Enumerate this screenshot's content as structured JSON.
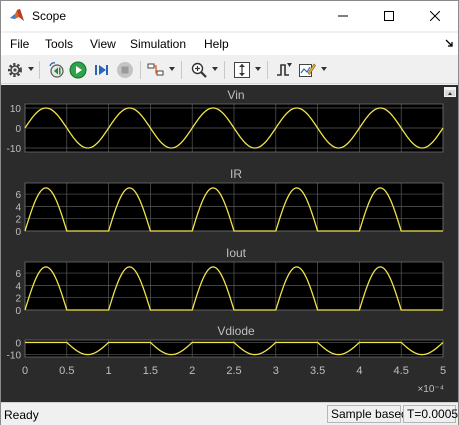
{
  "window": {
    "title": "Scope",
    "app_icon": "matlab-logo-icon"
  },
  "titlebar_buttons": [
    "minimize-icon",
    "maximize-icon",
    "close-icon"
  ],
  "menu": {
    "items": [
      "File",
      "Tools",
      "View",
      "Simulation",
      "Help"
    ],
    "overflow_icon": "chevron-arrow-icon"
  },
  "toolbar": {
    "icons": [
      "gear-icon",
      "dropdown-icon",
      "step-back-icon",
      "run-icon",
      "step-forward-icon",
      "stop-icon",
      "signal-select-icon",
      "dropdown-icon",
      "zoom-icon",
      "dropdown-icon",
      "fit-axes-icon",
      "dropdown-icon",
      "trigger-icon",
      "style-edit-icon",
      "dropdown-icon"
    ]
  },
  "colors": {
    "plot_background": "#2b2b2b",
    "axes_background": "#000000",
    "trace": "#f0e44a",
    "grid": "#5a5a5a",
    "text": "#bfbfbf"
  },
  "chart_data": [
    {
      "type": "line",
      "title": "Vin",
      "x_range": [
        0,
        0.0005
      ],
      "ylim": [
        -12,
        12
      ],
      "yticks": [
        "10",
        "0",
        "-10"
      ],
      "series": [
        {
          "waveform": "sine",
          "amplitude": 10,
          "frequency_hz": 10000
        }
      ]
    },
    {
      "type": "line",
      "title": "IR",
      "x_range": [
        0,
        0.0005
      ],
      "ylim": [
        0,
        7.8
      ],
      "yticks": [
        "6",
        "4",
        "2",
        "0"
      ],
      "series": [
        {
          "waveform": "half-wave rectified sine",
          "peak": 7,
          "frequency_hz": 10000
        }
      ]
    },
    {
      "type": "line",
      "title": "Iout",
      "x_range": [
        0,
        0.0005
      ],
      "ylim": [
        0,
        7.8
      ],
      "yticks": [
        "6",
        "4",
        "2",
        "0"
      ],
      "series": [
        {
          "waveform": "half-wave rectified sine",
          "peak": 7,
          "frequency_hz": 10000
        }
      ]
    },
    {
      "type": "line",
      "title": "Vdiode",
      "x_range": [
        0,
        0.0005
      ],
      "ylim": [
        -12,
        2
      ],
      "yticks": [
        "0",
        "-10"
      ],
      "series": [
        {
          "waveform": "negative half-wave clipped sine",
          "min": -10,
          "frequency_hz": 10000
        }
      ]
    }
  ],
  "x_axis": {
    "ticks": [
      "0",
      "0.5",
      "1",
      "1.5",
      "2",
      "2.5",
      "3",
      "3.5",
      "4",
      "4.5",
      "5"
    ],
    "multiplier": "×10⁻⁴"
  },
  "status": {
    "state": "Ready",
    "mode": "Sample based",
    "time": "T=0.0005"
  }
}
